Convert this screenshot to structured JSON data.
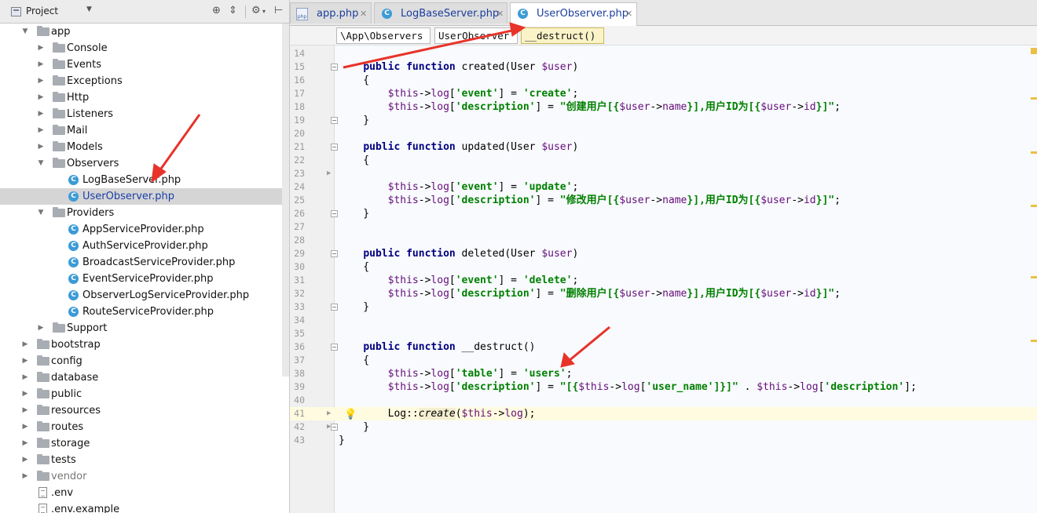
{
  "project_panel": {
    "title": "Project",
    "tools": [
      "target-icon",
      "collapse-icon",
      "gear-icon",
      "hide-icon"
    ]
  },
  "tree": [
    {
      "label": "app",
      "depth": 1,
      "type": "folder",
      "expanded": true
    },
    {
      "label": "Console",
      "depth": 2,
      "type": "folder",
      "expanded": false
    },
    {
      "label": "Events",
      "depth": 2,
      "type": "folder",
      "expanded": false
    },
    {
      "label": "Exceptions",
      "depth": 2,
      "type": "folder",
      "expanded": false
    },
    {
      "label": "Http",
      "depth": 2,
      "type": "folder",
      "expanded": false
    },
    {
      "label": "Listeners",
      "depth": 2,
      "type": "folder",
      "expanded": false
    },
    {
      "label": "Mail",
      "depth": 2,
      "type": "folder",
      "expanded": false
    },
    {
      "label": "Models",
      "depth": 2,
      "type": "folder",
      "expanded": false
    },
    {
      "label": "Observers",
      "depth": 2,
      "type": "folder",
      "expanded": true
    },
    {
      "label": "LogBaseServer.php",
      "depth": 3,
      "type": "class"
    },
    {
      "label": "UserObserver.php",
      "depth": 3,
      "type": "class",
      "selected": true
    },
    {
      "label": "Providers",
      "depth": 2,
      "type": "folder",
      "expanded": true
    },
    {
      "label": "AppServiceProvider.php",
      "depth": 3,
      "type": "class"
    },
    {
      "label": "AuthServiceProvider.php",
      "depth": 3,
      "type": "class"
    },
    {
      "label": "BroadcastServiceProvider.php",
      "depth": 3,
      "type": "class"
    },
    {
      "label": "EventServiceProvider.php",
      "depth": 3,
      "type": "class"
    },
    {
      "label": "ObserverLogServiceProvider.php",
      "depth": 3,
      "type": "class"
    },
    {
      "label": "RouteServiceProvider.php",
      "depth": 3,
      "type": "class"
    },
    {
      "label": "Support",
      "depth": 2,
      "type": "folder",
      "expanded": false
    },
    {
      "label": "bootstrap",
      "depth": 1,
      "type": "folder",
      "expanded": false
    },
    {
      "label": "config",
      "depth": 1,
      "type": "folder",
      "expanded": false
    },
    {
      "label": "database",
      "depth": 1,
      "type": "folder",
      "expanded": false
    },
    {
      "label": "public",
      "depth": 1,
      "type": "folder",
      "expanded": false
    },
    {
      "label": "resources",
      "depth": 1,
      "type": "folder",
      "expanded": false
    },
    {
      "label": "routes",
      "depth": 1,
      "type": "folder",
      "expanded": false
    },
    {
      "label": "storage",
      "depth": 1,
      "type": "folder",
      "expanded": false
    },
    {
      "label": "tests",
      "depth": 1,
      "type": "folder",
      "expanded": false
    },
    {
      "label": "vendor",
      "depth": 1,
      "type": "folder",
      "expanded": false,
      "dim": true
    },
    {
      "label": ".env",
      "depth": 1,
      "type": "file"
    },
    {
      "label": ".env.example",
      "depth": 1,
      "type": "file"
    }
  ],
  "tabs": [
    {
      "label": "app.php",
      "icon": "php-file-icon",
      "active": false
    },
    {
      "label": "LogBaseServer.php",
      "icon": "class-icon",
      "active": false
    },
    {
      "label": "UserObserver.php",
      "icon": "class-icon",
      "active": true
    }
  ],
  "breadcrumbs": [
    "\\App\\Observers",
    "UserObserver",
    "__destruct()"
  ],
  "code_lines": [
    {
      "n": "14",
      "t": [
        [
          "",
          ""
        ]
      ]
    },
    {
      "n": "15",
      "t": [
        [
          "    ",
          ""
        ],
        [
          "public",
          "kw"
        ],
        [
          " ",
          ""
        ],
        [
          "function",
          "kw"
        ],
        [
          " created(User ",
          ""
        ],
        [
          "$user",
          "var"
        ],
        [
          ")",
          ""
        ]
      ]
    },
    {
      "n": "16",
      "t": [
        [
          "    {",
          ""
        ]
      ]
    },
    {
      "n": "17",
      "t": [
        [
          "        ",
          ""
        ],
        [
          "$this",
          "var"
        ],
        [
          "->",
          ""
        ],
        [
          "log",
          "fld"
        ],
        [
          "[",
          ""
        ],
        [
          "'event'",
          "str"
        ],
        [
          "] = ",
          ""
        ],
        [
          "'create'",
          "str"
        ],
        [
          ";",
          ""
        ]
      ]
    },
    {
      "n": "18",
      "t": [
        [
          "        ",
          ""
        ],
        [
          "$this",
          "var"
        ],
        [
          "->",
          ""
        ],
        [
          "log",
          "fld"
        ],
        [
          "[",
          ""
        ],
        [
          "'description'",
          "str"
        ],
        [
          "] = ",
          ""
        ],
        [
          "\"创建用户[{",
          "str"
        ],
        [
          "$user",
          "var"
        ],
        [
          "->",
          ""
        ],
        [
          "name",
          "fld"
        ],
        [
          "}],用户ID为[{",
          "str"
        ],
        [
          "$user",
          "var"
        ],
        [
          "->",
          ""
        ],
        [
          "id",
          "fld"
        ],
        [
          "}]\"",
          "str"
        ],
        [
          ";",
          ""
        ]
      ]
    },
    {
      "n": "19",
      "t": [
        [
          "    }",
          ""
        ]
      ]
    },
    {
      "n": "20",
      "t": [
        [
          "",
          ""
        ]
      ]
    },
    {
      "n": "21",
      "t": [
        [
          "    ",
          ""
        ],
        [
          "public",
          "kw"
        ],
        [
          " ",
          ""
        ],
        [
          "function",
          "kw"
        ],
        [
          " updated(User ",
          ""
        ],
        [
          "$user",
          "var"
        ],
        [
          ")",
          ""
        ]
      ]
    },
    {
      "n": "22",
      "t": [
        [
          "    {",
          ""
        ]
      ]
    },
    {
      "n": "23",
      "t": [
        [
          "",
          ""
        ]
      ]
    },
    {
      "n": "24",
      "t": [
        [
          "        ",
          ""
        ],
        [
          "$this",
          "var"
        ],
        [
          "->",
          ""
        ],
        [
          "log",
          "fld"
        ],
        [
          "[",
          ""
        ],
        [
          "'event'",
          "str"
        ],
        [
          "] = ",
          ""
        ],
        [
          "'update'",
          "str"
        ],
        [
          ";",
          ""
        ]
      ]
    },
    {
      "n": "25",
      "t": [
        [
          "        ",
          ""
        ],
        [
          "$this",
          "var"
        ],
        [
          "->",
          ""
        ],
        [
          "log",
          "fld"
        ],
        [
          "[",
          ""
        ],
        [
          "'description'",
          "str"
        ],
        [
          "] = ",
          ""
        ],
        [
          "\"修改用户[{",
          "str"
        ],
        [
          "$user",
          "var"
        ],
        [
          "->",
          ""
        ],
        [
          "name",
          "fld"
        ],
        [
          "}],用户ID为[{",
          "str"
        ],
        [
          "$user",
          "var"
        ],
        [
          "->",
          ""
        ],
        [
          "id",
          "fld"
        ],
        [
          "}]\"",
          "str"
        ],
        [
          ";",
          ""
        ]
      ]
    },
    {
      "n": "26",
      "t": [
        [
          "    }",
          ""
        ]
      ]
    },
    {
      "n": "27",
      "t": [
        [
          "",
          ""
        ]
      ]
    },
    {
      "n": "28",
      "t": [
        [
          "",
          ""
        ]
      ]
    },
    {
      "n": "29",
      "t": [
        [
          "    ",
          ""
        ],
        [
          "public",
          "kw"
        ],
        [
          " ",
          ""
        ],
        [
          "function",
          "kw"
        ],
        [
          " deleted(User ",
          ""
        ],
        [
          "$user",
          "var"
        ],
        [
          ")",
          ""
        ]
      ]
    },
    {
      "n": "30",
      "t": [
        [
          "    {",
          ""
        ]
      ]
    },
    {
      "n": "31",
      "t": [
        [
          "        ",
          ""
        ],
        [
          "$this",
          "var"
        ],
        [
          "->",
          ""
        ],
        [
          "log",
          "fld"
        ],
        [
          "[",
          ""
        ],
        [
          "'event'",
          "str"
        ],
        [
          "] = ",
          ""
        ],
        [
          "'delete'",
          "str"
        ],
        [
          ";",
          ""
        ]
      ]
    },
    {
      "n": "32",
      "t": [
        [
          "        ",
          ""
        ],
        [
          "$this",
          "var"
        ],
        [
          "->",
          ""
        ],
        [
          "log",
          "fld"
        ],
        [
          "[",
          ""
        ],
        [
          "'description'",
          "str"
        ],
        [
          "] = ",
          ""
        ],
        [
          "\"删除用户[{",
          "str"
        ],
        [
          "$user",
          "var"
        ],
        [
          "->",
          ""
        ],
        [
          "name",
          "fld"
        ],
        [
          "}],用户ID为[{",
          "str"
        ],
        [
          "$user",
          "var"
        ],
        [
          "->",
          ""
        ],
        [
          "id",
          "fld"
        ],
        [
          "}]\"",
          "str"
        ],
        [
          ";",
          ""
        ]
      ]
    },
    {
      "n": "33",
      "t": [
        [
          "    }",
          ""
        ]
      ]
    },
    {
      "n": "34",
      "t": [
        [
          "",
          ""
        ]
      ]
    },
    {
      "n": "35",
      "t": [
        [
          "",
          ""
        ]
      ]
    },
    {
      "n": "36",
      "t": [
        [
          "    ",
          ""
        ],
        [
          "public",
          "kw"
        ],
        [
          " ",
          ""
        ],
        [
          "function",
          "kw"
        ],
        [
          " __destruct()",
          ""
        ]
      ]
    },
    {
      "n": "37",
      "t": [
        [
          "    {",
          ""
        ]
      ]
    },
    {
      "n": "38",
      "t": [
        [
          "        ",
          ""
        ],
        [
          "$this",
          "var"
        ],
        [
          "->",
          ""
        ],
        [
          "log",
          "fld"
        ],
        [
          "[",
          ""
        ],
        [
          "'table'",
          "str"
        ],
        [
          "] = ",
          ""
        ],
        [
          "'users'",
          "str"
        ],
        [
          ";",
          ""
        ]
      ]
    },
    {
      "n": "39",
      "t": [
        [
          "        ",
          ""
        ],
        [
          "$this",
          "var"
        ],
        [
          "->",
          ""
        ],
        [
          "log",
          "fld"
        ],
        [
          "[",
          ""
        ],
        [
          "'description'",
          "str"
        ],
        [
          "] = ",
          ""
        ],
        [
          "\"[{",
          "str"
        ],
        [
          "$this",
          "var"
        ],
        [
          "->",
          ""
        ],
        [
          "log",
          "fld"
        ],
        [
          "[",
          ""
        ],
        [
          "'user_name'",
          "str"
        ],
        [
          "]}]\"",
          "str"
        ],
        [
          " . ",
          ""
        ],
        [
          "$this",
          "var"
        ],
        [
          "->",
          ""
        ],
        [
          "log",
          "fld"
        ],
        [
          "[",
          ""
        ],
        [
          "'description'",
          "str"
        ],
        [
          "];",
          ""
        ]
      ]
    },
    {
      "n": "40",
      "t": [
        [
          "",
          ""
        ]
      ]
    },
    {
      "n": "41",
      "t": [
        [
          "        Log::",
          ""
        ],
        [
          "create",
          "ital"
        ],
        [
          "(",
          ""
        ],
        [
          "$this",
          "var"
        ],
        [
          "->",
          ""
        ],
        [
          "log",
          "fld"
        ],
        [
          ");",
          ""
        ]
      ],
      "current": true
    },
    {
      "n": "42",
      "t": [
        [
          "    }",
          ""
        ]
      ]
    },
    {
      "n": "43",
      "t": [
        [
          "}",
          ""
        ]
      ]
    }
  ],
  "colors": {
    "accent": "#1c3f9e",
    "annotation_arrow": "#e8332a",
    "keyword": "#000080",
    "string": "#008000",
    "variable": "#660e7a"
  }
}
